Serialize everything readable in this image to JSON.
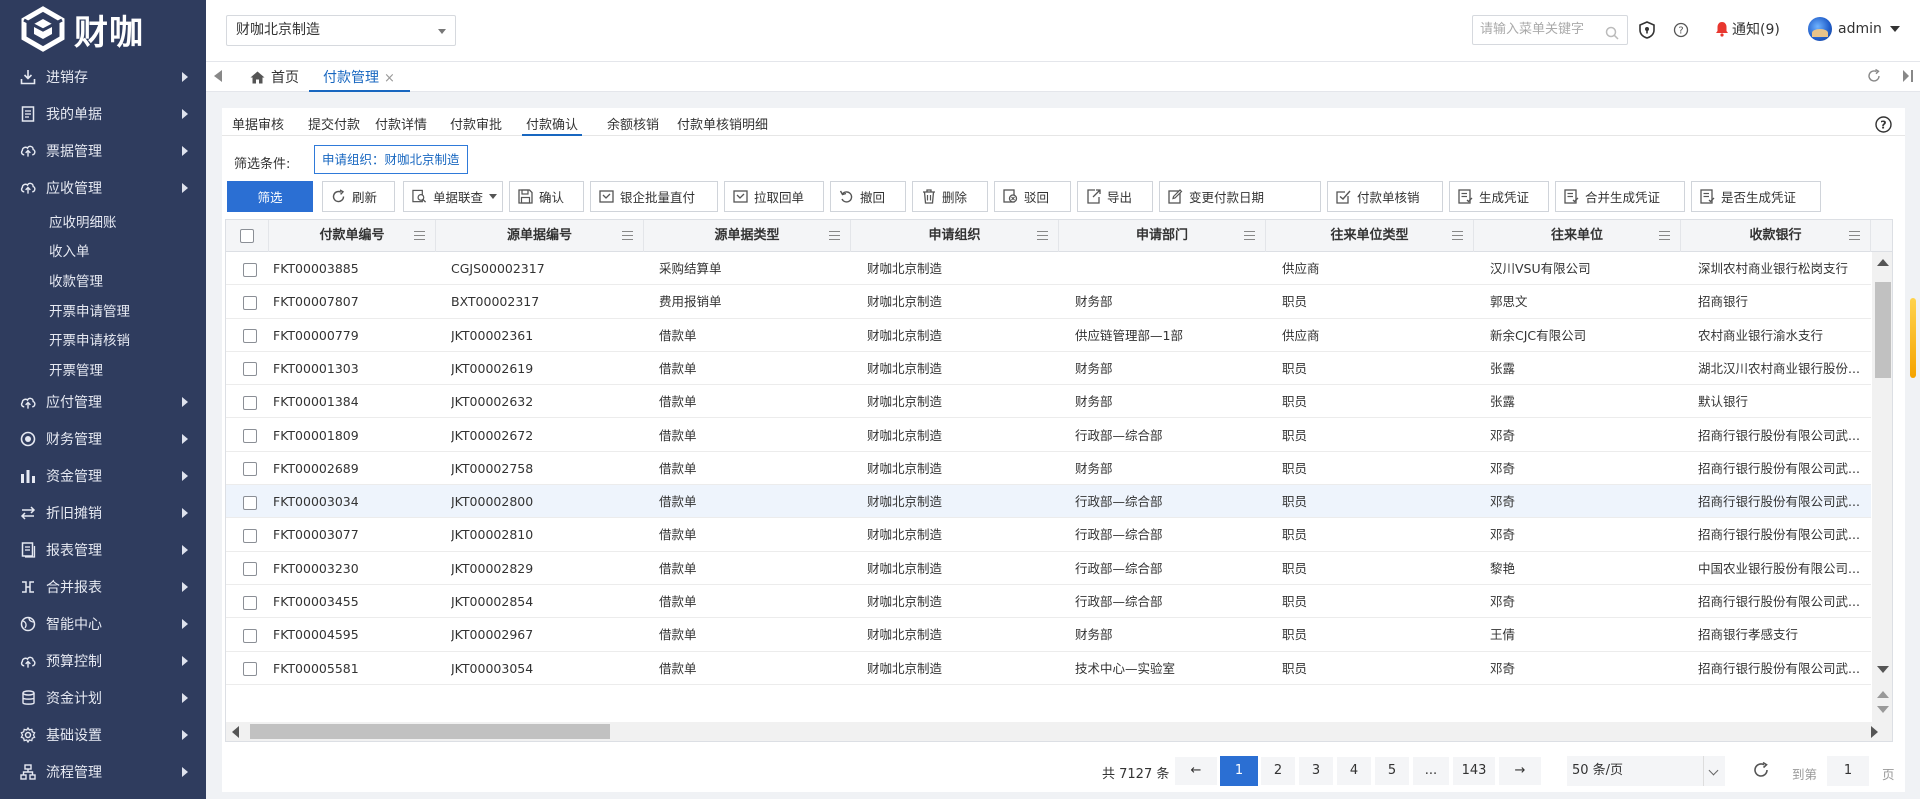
{
  "app": {
    "logo_text": "财咖"
  },
  "sidebar": {
    "items": [
      {
        "label": "进销存",
        "icon": "download-tray-icon"
      },
      {
        "label": "我的单据",
        "icon": "document-icon"
      },
      {
        "label": "票据管理",
        "icon": "cloud-upload-icon"
      },
      {
        "label": "应收管理",
        "icon": "cloud-upload-icon",
        "expanded": true,
        "children": [
          "应收明细账",
          "收入单",
          "收款管理",
          "开票申请管理",
          "开票申请核销",
          "开票管理"
        ]
      },
      {
        "label": "应付管理",
        "icon": "cloud-upload-icon"
      },
      {
        "label": "财务管理",
        "icon": "circle-dot-icon"
      },
      {
        "label": "资金管理",
        "icon": "bar-chart-icon"
      },
      {
        "label": "折旧摊销",
        "icon": "swap-icon"
      },
      {
        "label": "报表管理",
        "icon": "report-icon"
      },
      {
        "label": "合并报表",
        "icon": "merge-icon"
      },
      {
        "label": "智能中心",
        "icon": "globe-icon"
      },
      {
        "label": "预算控制",
        "icon": "cloud-upload-icon"
      },
      {
        "label": "资金计划",
        "icon": "database-icon"
      },
      {
        "label": "基础设置",
        "icon": "gear-icon"
      },
      {
        "label": "流程管理",
        "icon": "flow-icon"
      }
    ]
  },
  "header": {
    "org": "财咖北京制造",
    "search_placeholder": "请输入菜单关键字",
    "notice": "通知(9)",
    "user": "admin"
  },
  "tabs": {
    "home": "首页",
    "active": "付款管理",
    "close": "×"
  },
  "subtabs": [
    "单据审核",
    "提交付款",
    "付款详情",
    "付款审批",
    "付款确认",
    "余额核销",
    "付款单核销明细"
  ],
  "subtab_active": 4,
  "filter": {
    "label": "筛选条件:",
    "chip": "申请组织：财咖北京制造"
  },
  "toolbar": {
    "filter": "筛选",
    "buttons": [
      "刷新",
      "单据联查",
      "确认",
      "银企批量直付",
      "拉取回单",
      "撤回",
      "删除",
      "驳回",
      "导出",
      "变更付款日期",
      "付款单核销",
      "生成凭证",
      "合并生成凭证",
      "是否生成凭证"
    ]
  },
  "table": {
    "columns": [
      "付款单编号",
      "源单据编号",
      "源单据类型",
      "申请组织",
      "申请部门",
      "往来单位类型",
      "往来单位",
      "收款银行"
    ],
    "rows": [
      [
        "FKT00003885",
        "CGJS00002317",
        "采购结算单",
        "财咖北京制造",
        "",
        "供应商",
        "汉川VSU有限公司",
        "深圳农村商业银行松岗支行"
      ],
      [
        "FKT00007807",
        "BXT00002317",
        "费用报销单",
        "财咖北京制造",
        "财务部",
        "职员",
        "郭思文",
        "招商银行"
      ],
      [
        "FKT00000779",
        "JKT00002361",
        "借款单",
        "财咖北京制造",
        "供应链管理部—1部",
        "供应商",
        "新余CJC有限公司",
        "农村商业银行渝水支行"
      ],
      [
        "FKT00001303",
        "JKT00002619",
        "借款单",
        "财咖北京制造",
        "财务部",
        "职员",
        "张露",
        "湖北汉川农村商业银行股份..."
      ],
      [
        "FKT00001384",
        "JKT00002632",
        "借款单",
        "财咖北京制造",
        "财务部",
        "职员",
        "张露",
        "默认银行"
      ],
      [
        "FKT00001809",
        "JKT00002672",
        "借款单",
        "财咖北京制造",
        "行政部—综合部",
        "职员",
        "邓奇",
        "招商行银行股份有限公司武..."
      ],
      [
        "FKT00002689",
        "JKT00002758",
        "借款单",
        "财咖北京制造",
        "财务部",
        "职员",
        "邓奇",
        "招商行银行股份有限公司武..."
      ],
      [
        "FKT00003034",
        "JKT00002800",
        "借款单",
        "财咖北京制造",
        "行政部—综合部",
        "职员",
        "邓奇",
        "招商行银行股份有限公司武..."
      ],
      [
        "FKT00003077",
        "JKT00002810",
        "借款单",
        "财咖北京制造",
        "行政部—综合部",
        "职员",
        "邓奇",
        "招商行银行股份有限公司武..."
      ],
      [
        "FKT00003230",
        "JKT00002829",
        "借款单",
        "财咖北京制造",
        "行政部—综合部",
        "职员",
        "黎艳",
        "中国农业银行股份有限公司..."
      ],
      [
        "FKT00003455",
        "JKT00002854",
        "借款单",
        "财咖北京制造",
        "行政部—综合部",
        "职员",
        "邓奇",
        "招商行银行股份有限公司武..."
      ],
      [
        "FKT00004595",
        "JKT00002967",
        "借款单",
        "财咖北京制造",
        "财务部",
        "职员",
        "王倩",
        "招商银行孝感支行"
      ],
      [
        "FKT00005581",
        "JKT00003054",
        "借款单",
        "财咖北京制造",
        "技术中心—实验室",
        "职员",
        "邓奇",
        "招商行银行股份有限公司武..."
      ]
    ],
    "highlighted_row": 7
  },
  "pagination": {
    "total": "共 7127 条",
    "prev": "←",
    "pages": [
      "1",
      "2",
      "3",
      "4",
      "5",
      "...",
      "143"
    ],
    "next": "→",
    "page_size": "50 条/页",
    "jump_label": "到第",
    "jump_value": "1",
    "jump_unit": "页"
  }
}
